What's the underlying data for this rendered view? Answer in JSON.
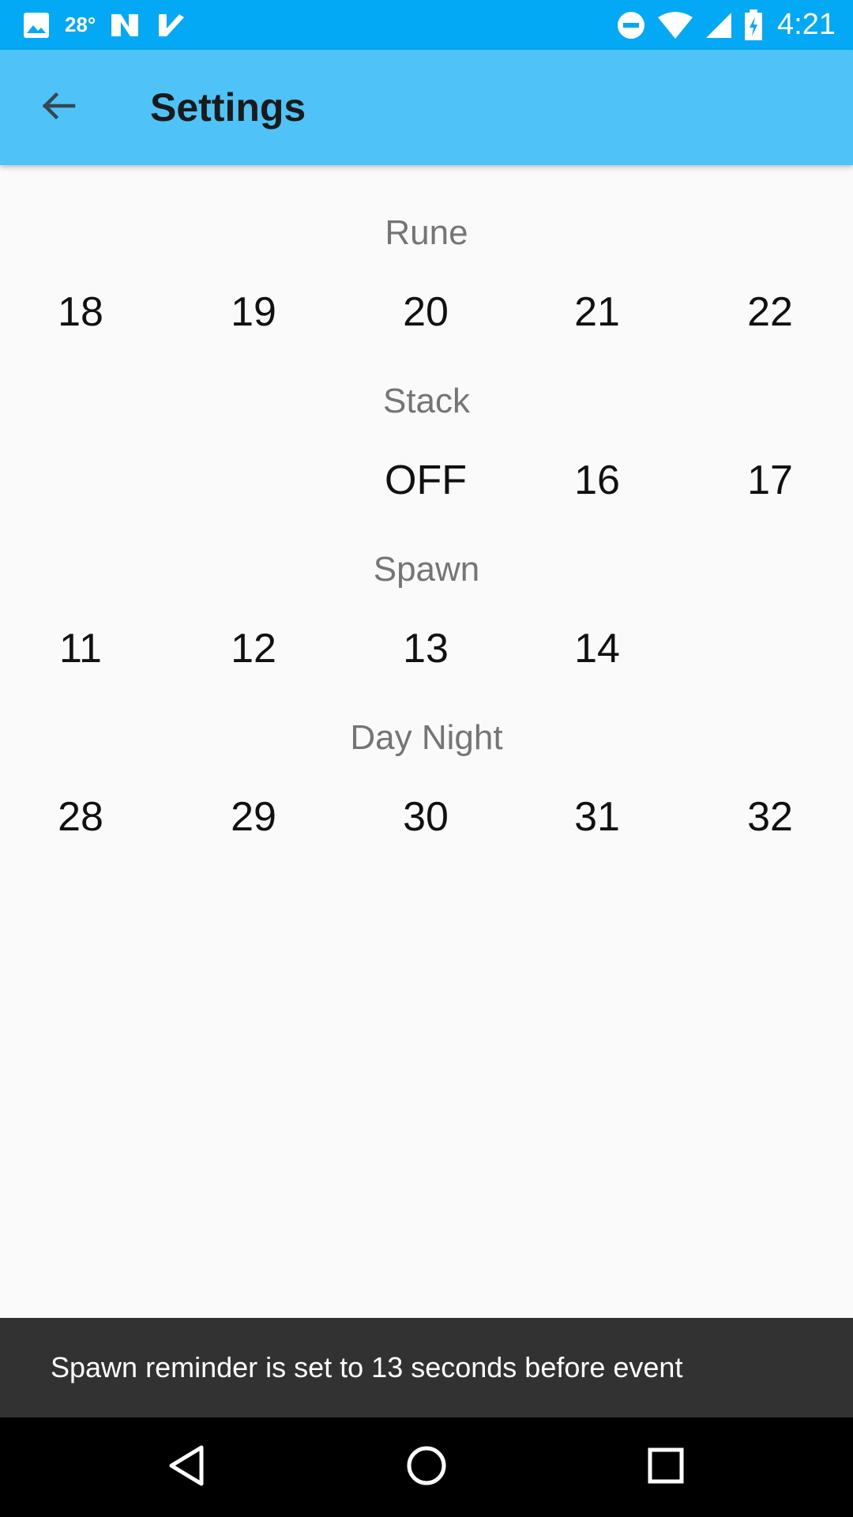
{
  "status_bar": {
    "temperature": "28°",
    "time": "4:21",
    "icons": [
      "image-icon",
      "weather-temp",
      "n-app-icon",
      "check-app-icon",
      "dnd-icon",
      "wifi-icon",
      "signal-icon",
      "battery-charging-icon"
    ]
  },
  "app_bar": {
    "title": "Settings",
    "back_icon": "arrow-back-icon",
    "color": "#4FC3F7"
  },
  "sections": [
    {
      "title": "Rune",
      "options": [
        "18",
        "19",
        "20",
        "21",
        "22"
      ]
    },
    {
      "title": "Stack",
      "options": [
        "OFF",
        "16",
        "17"
      ]
    },
    {
      "title": "Spawn",
      "options": [
        "11",
        "12",
        "13",
        "14"
      ]
    },
    {
      "title": "Day Night",
      "options": [
        "28",
        "29",
        "30",
        "31",
        "32"
      ]
    }
  ],
  "snackbar": {
    "message": "Spawn reminder is set to 13 seconds before event"
  },
  "nav_bar": {
    "icons": [
      "back-triangle-icon",
      "home-circle-icon",
      "recents-square-icon"
    ]
  },
  "colors": {
    "status_bar": "#03A9F4",
    "app_bar": "#4FC3F7",
    "background": "#FAFAFA",
    "snackbar": "#323232"
  }
}
